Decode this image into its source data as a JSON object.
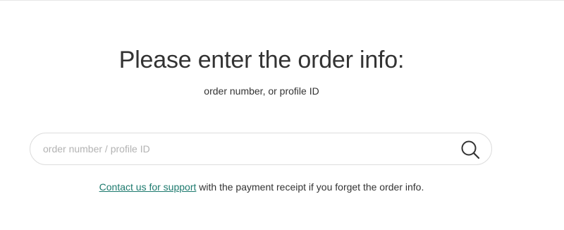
{
  "header": {
    "title": "Please enter the order info:",
    "subtitle": "order number, or profile ID"
  },
  "search": {
    "placeholder": "order number / profile ID",
    "value": "",
    "icon": "search-icon"
  },
  "support": {
    "link_text": "Contact us for support",
    "trailing_text": " with the payment receipt if you forget the order info."
  },
  "colors": {
    "link": "#1d7a6e",
    "text": "#333333",
    "placeholder": "#b3b3b3",
    "border": "#dddddd"
  }
}
